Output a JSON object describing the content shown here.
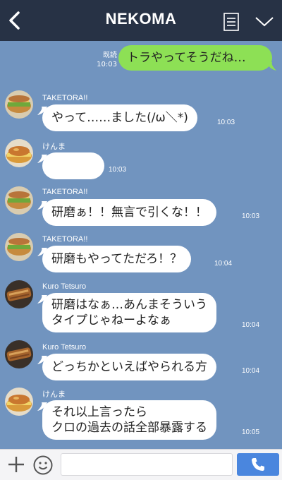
{
  "header": {
    "title": "NEKOMA",
    "back_icon": "chevron-left-icon",
    "menu_icon": "note-list-icon",
    "more_icon": "chevron-down-icon"
  },
  "sent": {
    "text": "トラやってそうだね…",
    "read_label": "既読",
    "time": "10:03"
  },
  "messages": [
    {
      "name": "TAKETORA!!",
      "lines": [
        "やって……ました(/ω＼*)"
      ],
      "time": "10:03",
      "avatar": "sandwich-avatar"
    },
    {
      "name": "けんま",
      "lines": [
        ""
      ],
      "time": "10:03",
      "avatar": "pie-avatar"
    },
    {
      "name": "TAKETORA!!",
      "lines": [
        "研磨ぁ！！無言で引くな！！"
      ],
      "time": "10:03",
      "avatar": "sandwich-avatar"
    },
    {
      "name": "TAKETORA!!",
      "lines": [
        "研磨もやってただろ！？"
      ],
      "time": "10:04",
      "avatar": "sandwich-avatar"
    },
    {
      "name": "Kuro Tetsuro",
      "lines": [
        "研磨はなぁ…あんまそういう",
        "タイプじゃねーよなぁ"
      ],
      "time": "10:04",
      "avatar": "grilled-fish-avatar"
    },
    {
      "name": "Kuro Tetsuro",
      "lines": [
        "どっちかといえばやられる方"
      ],
      "time": "10:04",
      "avatar": "grilled-fish-avatar"
    },
    {
      "name": "けんま",
      "lines": [
        "それ以上言ったら",
        "クロの過去の話全部暴露する"
      ],
      "time": "10:05",
      "avatar": "pie-avatar"
    }
  ],
  "footer": {
    "plus_icon": "plus-icon",
    "emoji_icon": "smiley-icon",
    "input_value": "",
    "call_icon": "phone-icon"
  },
  "colors": {
    "header_bg": "#273245",
    "chat_bg": "#7194bf",
    "sent_bubble": "#8de055",
    "received_bubble": "#ffffff",
    "call_button": "#4a86de"
  }
}
